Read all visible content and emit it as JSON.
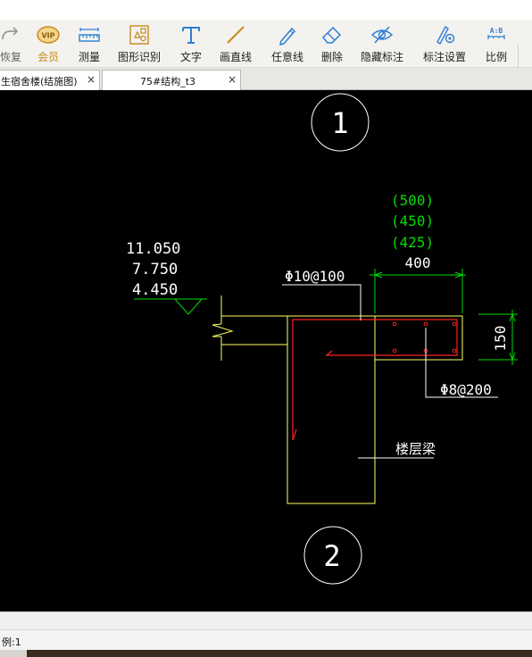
{
  "toolbar": {
    "items": [
      {
        "label": "恢复",
        "icon": "redo-icon"
      },
      {
        "label": "会员",
        "icon": "vip-icon"
      },
      {
        "label": "测量",
        "icon": "ruler-icon"
      },
      {
        "label": "图形识别",
        "icon": "shape-recognition-icon"
      },
      {
        "label": "文字",
        "icon": "text-icon"
      },
      {
        "label": "画直线",
        "icon": "line-icon"
      },
      {
        "label": "任意线",
        "icon": "pen-icon"
      },
      {
        "label": "删除",
        "icon": "eraser-icon"
      },
      {
        "label": "隐藏标注",
        "icon": "eye-hidden-icon"
      },
      {
        "label": "标注设置",
        "icon": "annotation-settings-icon"
      },
      {
        "label": "比例",
        "icon": "scale-icon"
      }
    ],
    "scale_glyph": "A:B"
  },
  "tabs": [
    {
      "title": "生宿舍楼(结施图)",
      "close": "×"
    },
    {
      "title": "75#结构_t3",
      "close": "×"
    }
  ],
  "drawing": {
    "axis_top": "1",
    "axis_bottom": "2",
    "green_dims": [
      "(500)",
      "(450)",
      "(425)"
    ],
    "dim_width": "400",
    "dim_height": "150",
    "elevations": [
      "11.050",
      "7.750",
      "4.450"
    ],
    "rebar_top": "Φ10@100",
    "rebar_slab": "Φ8@200",
    "beam_label": "楼层梁"
  },
  "colors": {
    "canvas_bg": "#000000",
    "cad_white": "#ffffff",
    "cad_yellow": "#ffff66",
    "cad_green": "#00dd00",
    "cad_red": "#ff2020",
    "vip_gold": "#c58a1a",
    "icon_blue": "#2a7fd4"
  },
  "status": {
    "scale_text": "例:1"
  }
}
